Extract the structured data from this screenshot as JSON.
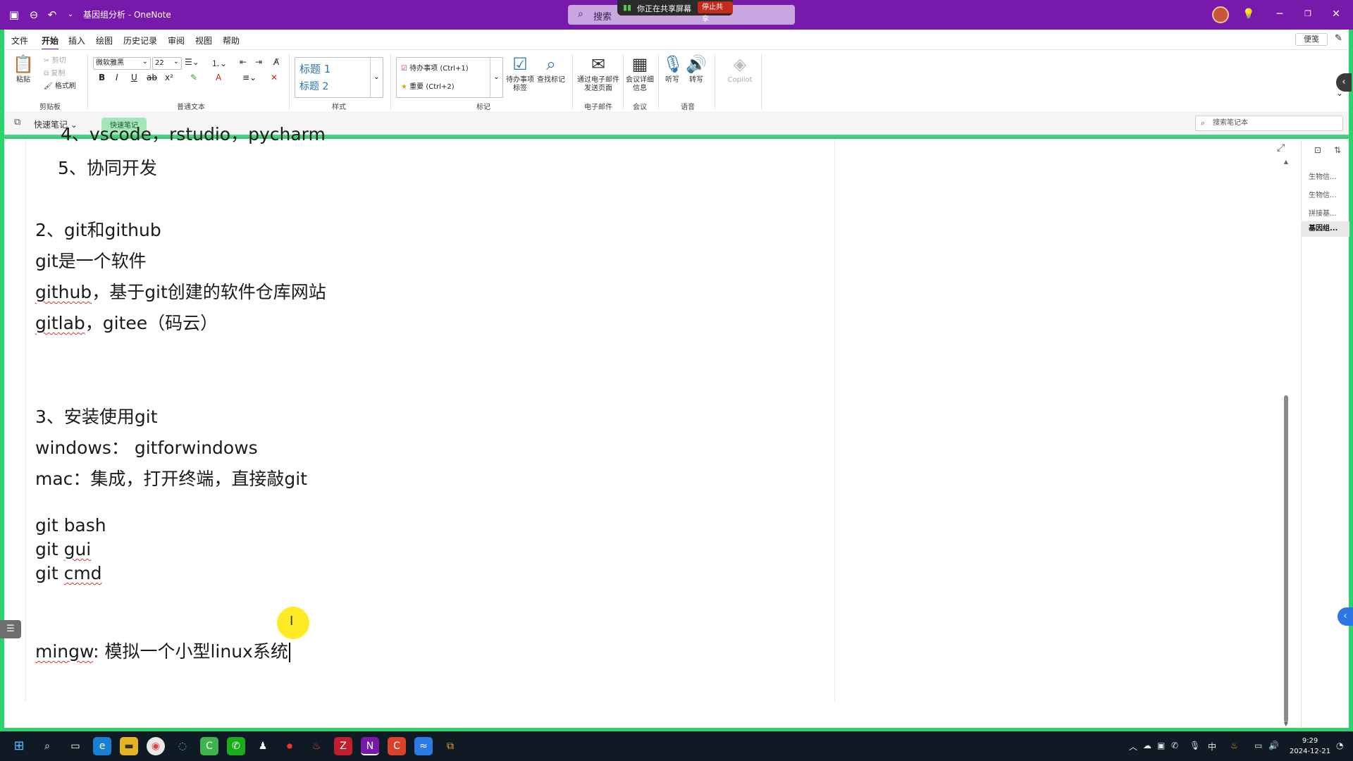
{
  "window": {
    "title": "基因组分析 - OneNote",
    "search_label": "搜索",
    "sharing_text": "你正在共享屏幕",
    "stop_share": "停止共享"
  },
  "menu": {
    "items": [
      "文件",
      "开始",
      "插入",
      "绘图",
      "历史记录",
      "审阅",
      "视图",
      "帮助"
    ],
    "active": "开始",
    "sticky_notes": "便笺"
  },
  "ribbon": {
    "clipboard": {
      "paste": "粘贴",
      "cut": "剪切",
      "copy": "复制",
      "format_painter": "格式刷",
      "label": "剪贴板"
    },
    "text": {
      "font": "微软雅黑",
      "size": "22",
      "label": "普通文本"
    },
    "styles": {
      "h1": "标题 1",
      "h2": "标题 2",
      "label": "样式"
    },
    "tags": {
      "todo": "待办事项 (Ctrl+1)",
      "important": "重要 (Ctrl+2)",
      "todo_outlook": "待办事项标签",
      "find_tags": "查找标记",
      "label": "标记"
    },
    "email": {
      "button": "通过电子邮件发送页面",
      "label": "电子邮件"
    },
    "meeting": {
      "button": "会议详细信息",
      "label": "会议"
    },
    "voice": {
      "dictate": "听写",
      "transcribe": "转写",
      "label": "语音"
    },
    "copilot": "Copilot"
  },
  "quickbar": {
    "notebook": "快速笔记",
    "section_tab": "快速笔记",
    "search_placeholder": "搜索笔记本"
  },
  "note": {
    "lines": [
      "4、vscode，rstudio，pycharm",
      "5、协同开发",
      "2、git和github",
      "git是一个软件",
      "github",
      "，基于git创建的软件仓库网站",
      "gitlab",
      "，gitee（码云）",
      "3、安装使用git",
      "windows：  gitforwindows",
      "mac：集成，打开终端，直接敲git",
      "git bash",
      "git ",
      "gui",
      "git ",
      "cmd",
      "mingw",
      ": 模拟一个小型linux系统"
    ]
  },
  "pages": [
    "生物信...",
    "生物信...",
    "拼接基...",
    "基因组..."
  ],
  "taskbar": {
    "time": "9:29",
    "date": "2024-12-21",
    "ime": "中"
  }
}
